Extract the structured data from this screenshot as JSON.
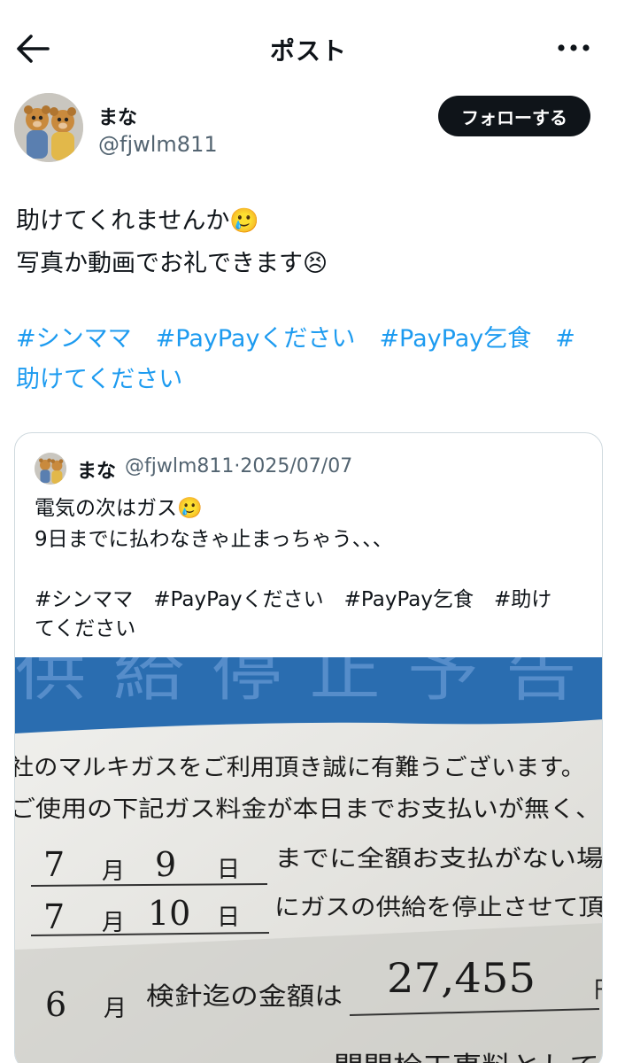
{
  "header": {
    "title": "ポスト",
    "back_icon": "arrow-left-icon",
    "more_icon": "more-dots-icon"
  },
  "author": {
    "name": "まな",
    "handle": "@fjwlm811",
    "follow_label": "フォローする"
  },
  "post": {
    "line1": "助けてくれませんか",
    "line1_emoji": "🥲",
    "line2": "写真か動画でお礼できます",
    "line2_emoji": "😣",
    "hashtags": [
      "#シンママ",
      "#PayPayください",
      "#PayPay乞食",
      "#",
      "助けてください"
    ]
  },
  "quoted": {
    "name": "まな",
    "handle": "@fjwlm811",
    "date": "2025/07/07",
    "line1": "電気の次はガス",
    "line1_emoji": "🥲",
    "line2": "9日までに払わなきゃ止まっちゃう、、、",
    "hashtags": [
      "#シンママ",
      "#PayPayください",
      "#PayPay乞食",
      "#助け",
      "てください"
    ],
    "image": {
      "banner": "供給停止予告",
      "line1": "社のマルキガスをご利用頂き誠に有難うございます。",
      "line2": "ご使用の下記ガス料金が本日までお支払いが無く、",
      "row1_month": "7",
      "row1_month_unit": "月",
      "row1_day": "9",
      "row1_day_unit": "日",
      "row1_text": "までに全額お支払がない場",
      "row2_month": "7",
      "row2_month_unit": "月",
      "row2_day": "10",
      "row2_day_unit": "日",
      "row2_text": "にガスの供給を停止させて頂",
      "amount_month": "6",
      "amount_month_unit": "月",
      "amount_label": "検針迄の金額は",
      "amount": "27,455",
      "amount_unit": "円",
      "bottom_partial": "開閉栓工事料として"
    }
  }
}
